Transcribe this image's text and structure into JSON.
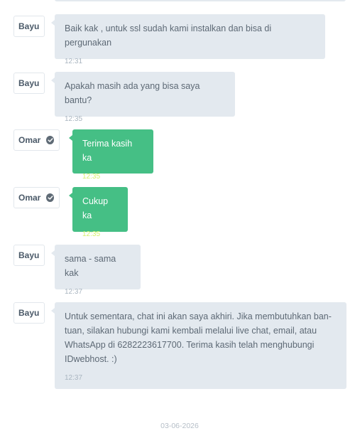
{
  "colors": {
    "staff_bubble": "#e3e9ef",
    "client_bubble": "#45bf85",
    "client_time": "#d4f16a"
  },
  "messages": [
    {
      "sender": "Bayu",
      "verified": false,
      "role": "staff",
      "text": "Baik kak , untuk ssl sudah kami instalkan dan bisa di pergunakan",
      "time": "12:31"
    },
    {
      "sender": "Bayu",
      "verified": false,
      "role": "staff",
      "text": "Apakah masih ada yang bisa saya bantu?",
      "time": "12:35"
    },
    {
      "sender": "Omar",
      "verified": true,
      "role": "client",
      "text": "Terima kasih ka",
      "time": "12:35"
    },
    {
      "sender": "Omar",
      "verified": true,
      "role": "client",
      "text": "Cukup ka",
      "time": "12:35"
    },
    {
      "sender": "Bayu",
      "verified": false,
      "role": "staff",
      "text": "sama - sama kak",
      "time": "12:37"
    },
    {
      "sender": "Bayu",
      "verified": false,
      "role": "staff",
      "text": "Untuk sementara, chat ini akan saya akhiri. Jika membutuhkan ban-tuan, silakan hubungi kami kembali melalui live chat, email, atau WhatsApp di 6282223617700. Terima kasih telah menghubungi IDwebhost. :)",
      "time": "12:37"
    }
  ],
  "footer": {
    "date": "03-06-2026"
  },
  "icons": {
    "verified": "check-circle-icon"
  }
}
